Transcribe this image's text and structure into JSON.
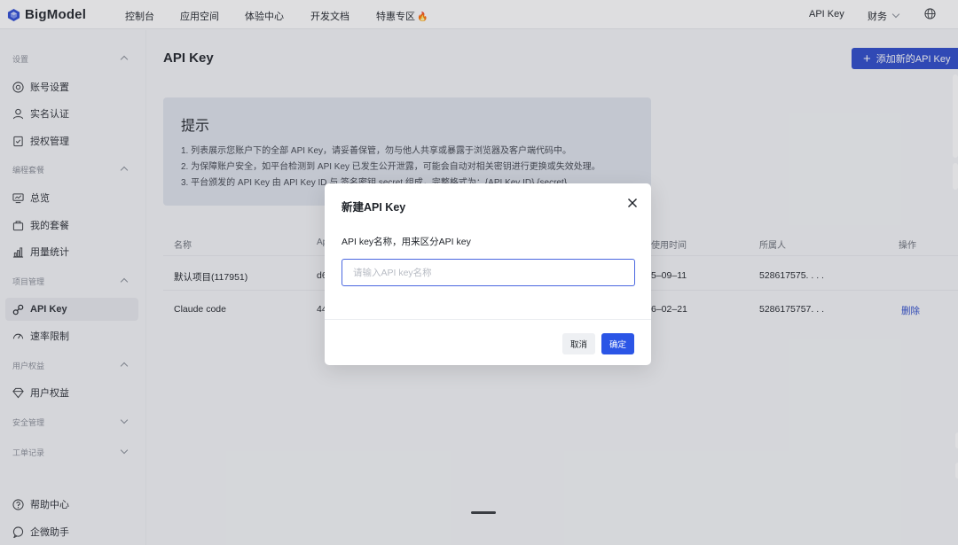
{
  "brand": {
    "name": "BigModel"
  },
  "nav": {
    "links": [
      "控制台",
      "应用空间",
      "体验中心",
      "开发文档",
      "特惠专区"
    ],
    "fire_icon": "fire-icon",
    "api_key": "API Key",
    "finance": "财务",
    "globe_icon": "globe-icon"
  },
  "sidebar": {
    "groups": [
      {
        "title": "设置",
        "items": [
          "账号设置",
          "实名认证",
          "授权管理"
        ]
      },
      {
        "title": "编程套餐",
        "items": [
          "总览",
          "我的套餐",
          "用量统计"
        ]
      },
      {
        "title": "项目管理",
        "items": [
          "API Key",
          "速率限制"
        ]
      },
      {
        "title": "用户权益",
        "items": [
          "用户权益"
        ]
      },
      {
        "title": "安全管理",
        "items": []
      },
      {
        "title": "工单记录",
        "items": []
      }
    ],
    "active_item": "API Key",
    "footer": [
      "帮助中心",
      "企微助手"
    ]
  },
  "page": {
    "title": "API Key",
    "add_button": "添加新的API Key"
  },
  "tip": {
    "title": "提示",
    "lines": [
      "1. 列表展示您账户下的全部 API Key，请妥善保管，勿与他人共享或暴露于浏览器及客户端代码中。",
      "2. 为保障账户安全，如平台检测到 API Key 已发生公开泄露，可能会自动对相关密钥进行更换或失效处理。",
      "3. 平台颁发的 API Key 由 API Key ID 与 签名密钥 secret 组成，完整格式为：{API Key ID}.{secret}"
    ]
  },
  "table": {
    "headers": {
      "name": "名称",
      "key": "Ap",
      "last_used": "使用时间",
      "owner": "所属人",
      "actions": "操作"
    },
    "rows": [
      {
        "name": "默认项目(117951)",
        "key": "d6",
        "last_used": "5–09–11",
        "owner": "528617575. . . .",
        "action": ""
      },
      {
        "name": "Claude code",
        "key": "44",
        "last_used": "6–02–21",
        "owner": "5286175757. . .",
        "action": "删除"
      }
    ]
  },
  "modal": {
    "title": "新建API Key",
    "label": "API key名称，用来区分API key",
    "input_placeholder": "请输入API key名称",
    "input_value": "",
    "cancel": "取消",
    "confirm": "确定"
  },
  "colors": {
    "primary": "#2b4acb",
    "confirm": "#2b55e6",
    "tip_bg": "#dfe3ec"
  }
}
